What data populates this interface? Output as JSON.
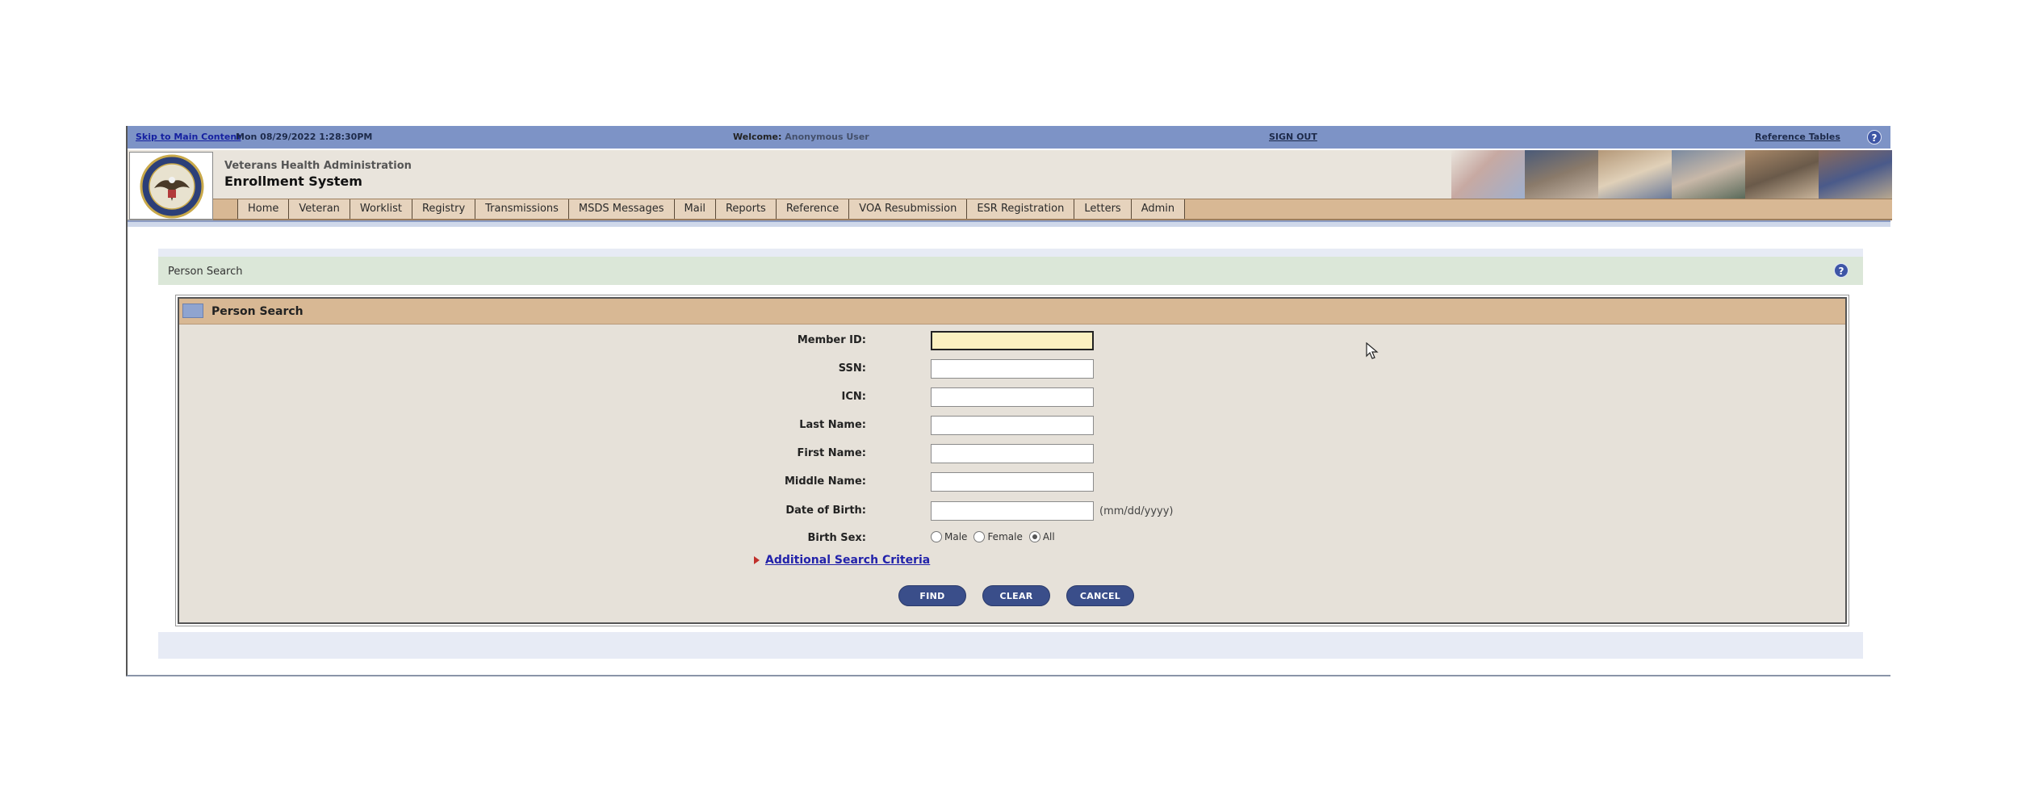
{
  "topbar": {
    "skip_link": "Skip to Main Content",
    "datetime": "Mon 08/29/2022 1:28:30PM",
    "welcome_label": "Welcome:",
    "welcome_user": "Anonymous User",
    "sign_out": "SIGN OUT",
    "reference_tables": "Reference Tables",
    "help": "?"
  },
  "header": {
    "org_name": "Veterans Health Administration",
    "app_name": "Enrollment System"
  },
  "nav": {
    "items": [
      "Home",
      "Veteran",
      "Worklist",
      "Registry",
      "Transmissions",
      "MSDS Messages",
      "Mail",
      "Reports",
      "Reference",
      "VOA Resubmission",
      "ESR Registration",
      "Letters",
      "Admin"
    ]
  },
  "breadcrumb": {
    "title": "Person Search",
    "help": "?"
  },
  "panel": {
    "title": "Person Search",
    "fields": {
      "member_id": {
        "label": "Member ID:",
        "value": ""
      },
      "ssn": {
        "label": "SSN:",
        "value": ""
      },
      "icn": {
        "label": "ICN:",
        "value": ""
      },
      "last_name": {
        "label": "Last Name:",
        "value": ""
      },
      "first_name": {
        "label": "First Name:",
        "value": ""
      },
      "middle_name": {
        "label": "Middle Name:",
        "value": ""
      },
      "dob": {
        "label": "Date of Birth:",
        "value": "",
        "hint": "(mm/dd/yyyy)"
      }
    },
    "birth_sex": {
      "label": "Birth Sex:",
      "options": [
        "Male",
        "Female",
        "All"
      ],
      "selected": "All"
    },
    "additional_link": "Additional Search Criteria",
    "buttons": {
      "find": "FIND",
      "clear": "CLEAR",
      "cancel": "CANCEL"
    }
  },
  "colors": {
    "topbar": "#7d93c6",
    "nav": "#d8b894",
    "button": "#3a4e8a",
    "focus_input": "#fbf0c0"
  }
}
